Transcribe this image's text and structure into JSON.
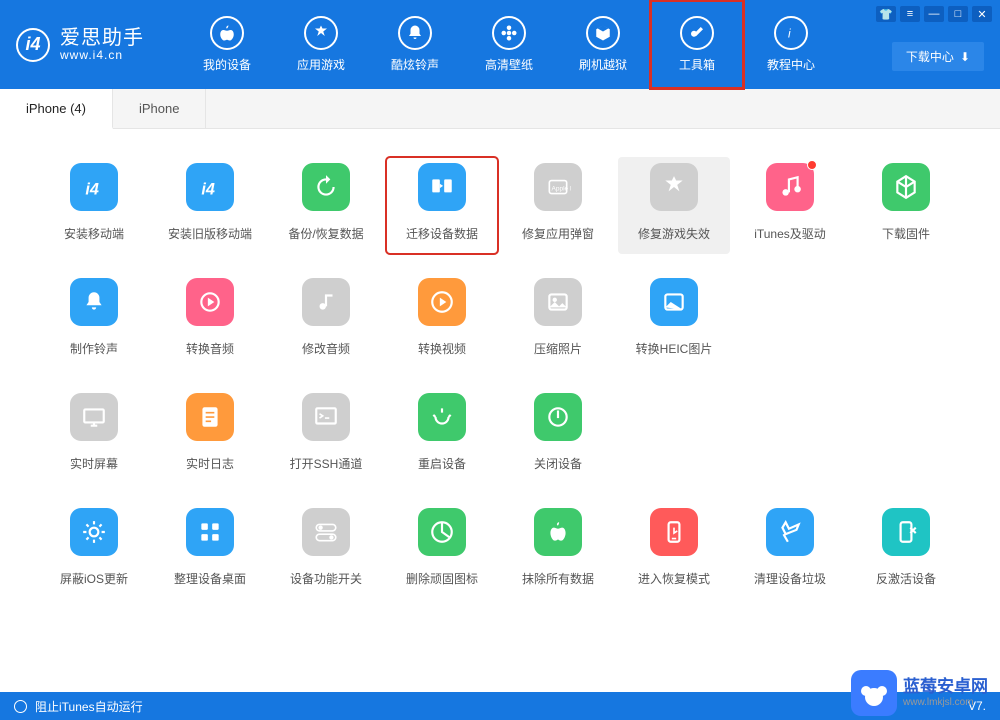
{
  "app": {
    "name": "爱思助手",
    "domain": "www.i4.cn"
  },
  "titlebar": {
    "shirt": "👕",
    "menu": "≡",
    "min": "—",
    "max": "□",
    "close": "✕"
  },
  "download_center": "下载中心",
  "nav": [
    {
      "label": "我的设备"
    },
    {
      "label": "应用游戏"
    },
    {
      "label": "酷炫铃声"
    },
    {
      "label": "高清壁纸"
    },
    {
      "label": "刷机越狱"
    },
    {
      "label": "工具箱"
    },
    {
      "label": "教程中心"
    }
  ],
  "tabs": [
    {
      "label": "iPhone (4)",
      "active": true
    },
    {
      "label": "iPhone",
      "active": false
    }
  ],
  "tools": [
    [
      {
        "label": "安装移动端",
        "color": "c-blue",
        "icon": "i4"
      },
      {
        "label": "安装旧版移动端",
        "color": "c-blue",
        "icon": "i4"
      },
      {
        "label": "备份/恢复数据",
        "color": "c-green",
        "icon": "restore"
      },
      {
        "label": "迁移设备数据",
        "color": "c-blue",
        "icon": "transfer",
        "highlighted": true
      },
      {
        "label": "修复应用弹窗",
        "color": "c-gray",
        "icon": "appleid"
      },
      {
        "label": "修复游戏失效",
        "color": "c-gray",
        "icon": "game",
        "bg": true
      },
      {
        "label": "iTunes及驱动",
        "color": "c-pink",
        "icon": "music",
        "badge": true
      },
      {
        "label": "下载固件",
        "color": "c-green",
        "icon": "cube"
      }
    ],
    [
      {
        "label": "制作铃声",
        "color": "c-blue",
        "icon": "bell"
      },
      {
        "label": "转换音频",
        "color": "c-pink",
        "icon": "audio"
      },
      {
        "label": "修改音频",
        "color": "c-gray",
        "icon": "edit-audio"
      },
      {
        "label": "转换视频",
        "color": "c-orange",
        "icon": "video"
      },
      {
        "label": "压缩照片",
        "color": "c-gray",
        "icon": "photo"
      },
      {
        "label": "转换HEIC图片",
        "color": "c-blue",
        "icon": "heic"
      }
    ],
    [
      {
        "label": "实时屏幕",
        "color": "c-gray",
        "icon": "screen"
      },
      {
        "label": "实时日志",
        "color": "c-orange",
        "icon": "log"
      },
      {
        "label": "打开SSH通道",
        "color": "c-gray",
        "icon": "ssh"
      },
      {
        "label": "重启设备",
        "color": "c-green",
        "icon": "restart"
      },
      {
        "label": "关闭设备",
        "color": "c-green",
        "icon": "power"
      }
    ],
    [
      {
        "label": "屏蔽iOS更新",
        "color": "c-blue",
        "icon": "gear"
      },
      {
        "label": "整理设备桌面",
        "color": "c-blue",
        "icon": "grid"
      },
      {
        "label": "设备功能开关",
        "color": "c-gray",
        "icon": "toggle"
      },
      {
        "label": "删除顽固图标",
        "color": "c-green",
        "icon": "pie"
      },
      {
        "label": "抹除所有数据",
        "color": "c-green",
        "icon": "apple"
      },
      {
        "label": "进入恢复模式",
        "color": "c-red",
        "icon": "recovery"
      },
      {
        "label": "清理设备垃圾",
        "color": "c-blue",
        "icon": "clean"
      },
      {
        "label": "反激活设备",
        "color": "c-teal",
        "icon": "deactivate"
      }
    ]
  ],
  "footer": {
    "left": "阻止iTunes自动运行",
    "right": "V7."
  },
  "watermark": {
    "main": "蓝莓安卓网",
    "sub": "www.lmkjsl.com"
  }
}
